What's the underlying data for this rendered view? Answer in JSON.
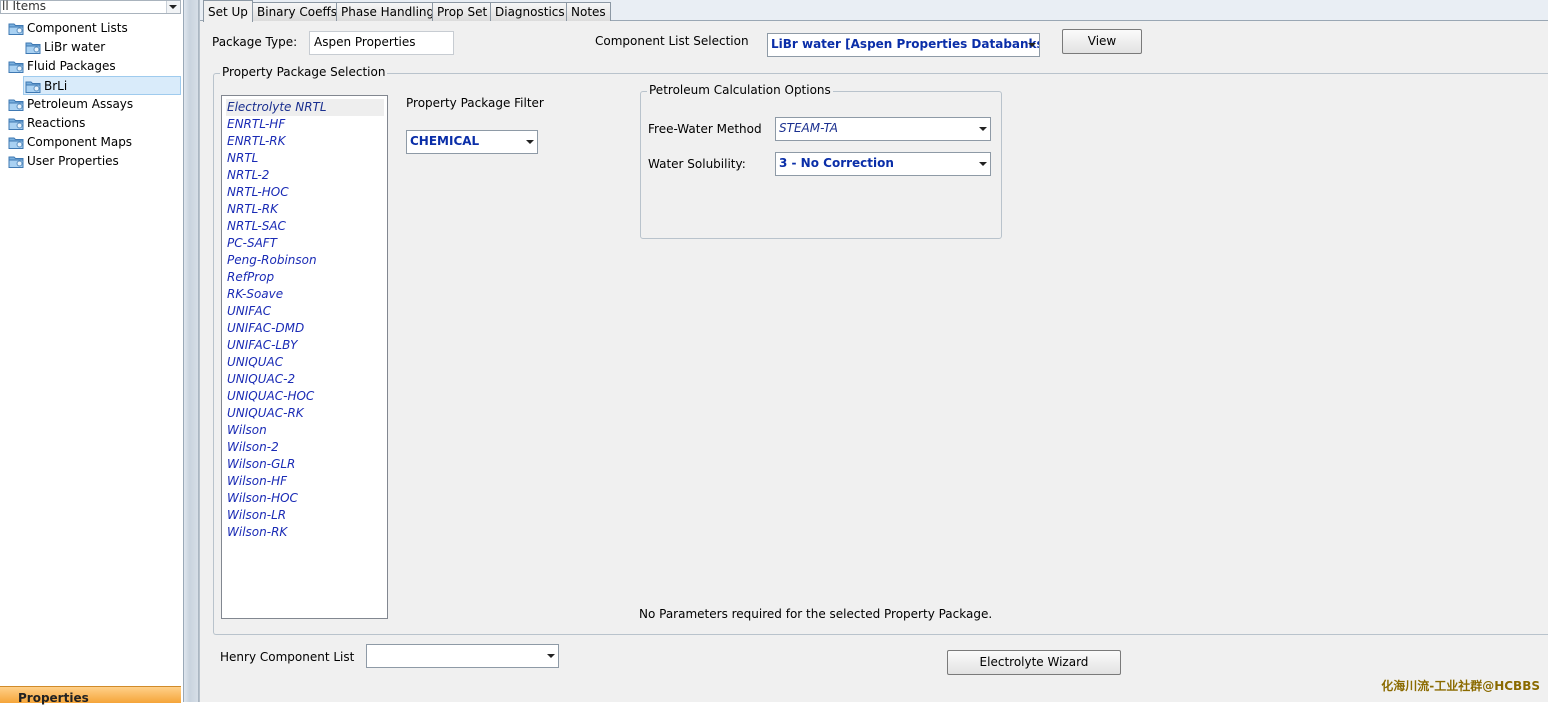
{
  "nav": {
    "combo_text": "ll Items",
    "tree": [
      {
        "label": "Component Lists",
        "indent": 0
      },
      {
        "label": "LiBr water",
        "indent": 1
      },
      {
        "label": "Fluid Packages",
        "indent": 0
      },
      {
        "label": "BrLi",
        "indent": 1,
        "selected": true
      },
      {
        "label": "Petroleum Assays",
        "indent": 0
      },
      {
        "label": "Reactions",
        "indent": 0
      },
      {
        "label": "Component Maps",
        "indent": 0
      },
      {
        "label": "User Properties",
        "indent": 0
      }
    ],
    "bottom_bar_label": "Properties"
  },
  "tabs": [
    "Set Up",
    "Binary Coeffs",
    "Phase Handling",
    "Prop Set",
    "Diagnostics",
    "Notes"
  ],
  "setup": {
    "package_type_label": "Package Type:",
    "package_type_value": "Aspen Properties",
    "component_list_label": "Component List Selection",
    "component_list_value": "LiBr water [Aspen Properties Databanks]",
    "view_button": "View",
    "property_package_selection_title": "Property Package Selection",
    "property_packages": [
      "Electrolyte NRTL",
      "ENRTL-HF",
      "ENRTL-RK",
      "NRTL",
      "NRTL-2",
      "NRTL-HOC",
      "NRTL-RK",
      "NRTL-SAC",
      "PC-SAFT",
      "Peng-Robinson",
      "RefProp",
      "RK-Soave",
      "UNIFAC",
      "UNIFAC-DMD",
      "UNIFAC-LBY",
      "UNIQUAC",
      "UNIQUAC-2",
      "UNIQUAC-HOC",
      "UNIQUAC-RK",
      "Wilson",
      "Wilson-2",
      "Wilson-GLR",
      "Wilson-HF",
      "Wilson-HOC",
      "Wilson-LR",
      "Wilson-RK"
    ],
    "selected_package": "Electrolyte NRTL",
    "filter_label": "Property Package Filter",
    "filter_value": "CHEMICAL",
    "petroleum_title": "Petroleum Calculation Options",
    "free_water_label": "Free-Water Method",
    "free_water_value": "STEAM-TA",
    "water_solubility_label": "Water Solubility:",
    "water_solubility_value": "3 - No Correction",
    "no_params_text": "No Parameters required for the selected Property Package.",
    "henry_label": "Henry Component List",
    "henry_value": "",
    "electrolyte_wizard_button": "Electrolyte Wizard"
  },
  "watermark": "化海川流-工业社群@HCBBS",
  "colors": {
    "tree_selection": "#d9ebfa",
    "list_text_blue": "#1a2bb5",
    "combo_text_blue": "#0a2ea8",
    "bottom_bar_orange": "#f5a53a"
  }
}
